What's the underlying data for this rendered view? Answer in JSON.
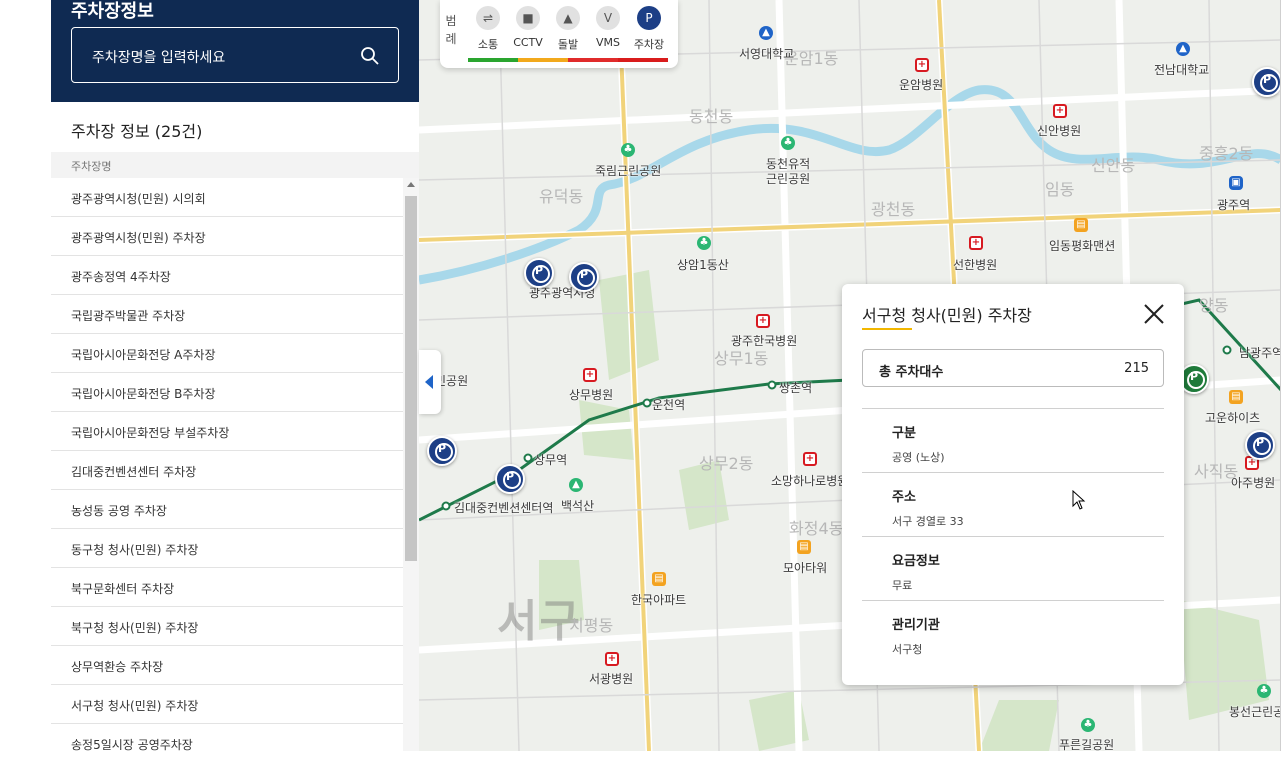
{
  "sidebar": {
    "title": "주차장정보",
    "search_placeholder": "주차장명을 입력하세요",
    "count_label": "주차장 정보 (25건)",
    "column_header": "주차장명",
    "items": [
      "광주광역시청(민원) 시의회",
      "광주광역시청(민원) 주차장",
      "광주송정역 4주차장",
      "국립광주박물관 주차장",
      "국립아시아문화전당 A주차장",
      "국립아시아문화전당 B주차장",
      "국립아시아문화전당 부설주차장",
      "김대중컨벤션센터 주차장",
      "농성동 공영 주차장",
      "동구청 청사(민원) 주차장",
      "북구문화센터 주차장",
      "북구청 청사(민원) 주차장",
      "상무역환승 주차장",
      "서구청 청사(민원) 주차장",
      "송정5일시장 공영주차장"
    ]
  },
  "legend": {
    "title": "범례",
    "items": [
      {
        "label": "소통",
        "icon": "arrows-icon",
        "glyph": "⇌",
        "bar_color": "#2aa52f"
      },
      {
        "label": "CCTV",
        "icon": "camera-icon",
        "glyph": "■",
        "bar_color": "#f2a91c"
      },
      {
        "label": "돌발",
        "icon": "warning-icon",
        "glyph": "▲",
        "bar_color": "#e02b2b"
      },
      {
        "label": "VMS",
        "icon": "vms-icon",
        "glyph": "V",
        "bar_color": "#d91c1c"
      },
      {
        "label": "주차장",
        "icon": "parking-icon",
        "glyph": "P",
        "bar_color": "#77787f"
      }
    ]
  },
  "detail": {
    "title": "서구청 청사(민원) 주차장",
    "total_label": "총 주차대수",
    "total_value": "215",
    "sections": [
      {
        "key": "구분",
        "value": "공영 (노상)"
      },
      {
        "key": "주소",
        "value": "서구 경열로 33"
      },
      {
        "key": "요금정보",
        "value": "무료"
      },
      {
        "key": "관리기관",
        "value": "서구청"
      }
    ]
  },
  "map": {
    "district": "서구",
    "places": [
      {
        "name": "서영대학교",
        "kind": "school"
      },
      {
        "name": "운암병원",
        "kind": "hosp"
      },
      {
        "name": "전남대학교",
        "kind": "school"
      },
      {
        "name": "신안병원",
        "kind": "hosp"
      },
      {
        "name": "죽림근린공원",
        "kind": "park"
      },
      {
        "name": "동천유적\n근린공원",
        "kind": "park"
      },
      {
        "name": "광주역",
        "kind": "sta"
      },
      {
        "name": "임동평화맨션",
        "kind": "apt"
      },
      {
        "name": "상암1동산",
        "kind": "park"
      },
      {
        "name": "선한병원",
        "kind": "hosp"
      },
      {
        "name": "광주광역시청",
        "kind": "none"
      },
      {
        "name": "광주한국병원",
        "kind": "hosp"
      },
      {
        "name": "상무병원",
        "kind": "hosp"
      },
      {
        "name": "운천역",
        "kind": "none"
      },
      {
        "name": "쌍촌역",
        "kind": "none"
      },
      {
        "name": "상무역",
        "kind": "none"
      },
      {
        "name": "김대중컨벤션센터역",
        "kind": "none"
      },
      {
        "name": "백석산",
        "kind": "park"
      },
      {
        "name": "소망하나로병원",
        "kind": "hosp"
      },
      {
        "name": "모아타워",
        "kind": "apt"
      },
      {
        "name": "한국아파트",
        "kind": "apt"
      },
      {
        "name": "서광병원",
        "kind": "hosp"
      },
      {
        "name": "푸른길공원",
        "kind": "park"
      },
      {
        "name": "봉선근린공원",
        "kind": "park"
      },
      {
        "name": "고운하이츠",
        "kind": "apt"
      },
      {
        "name": "아주병원",
        "kind": "hosp"
      },
      {
        "name": "남광주역",
        "kind": "none"
      },
      {
        "name": "민공원",
        "kind": "none"
      }
    ],
    "dongs": [
      "운암1동",
      "동천동",
      "유덕동",
      "광천동",
      "신안동",
      "임동",
      "상무1동",
      "상무2동",
      "치평동",
      "화정4동",
      "중흥2동",
      "양동",
      "사직동"
    ]
  },
  "colors": {
    "header_bg": "#0f2a52",
    "pin": "#1d3f86",
    "accent": "#f2b700",
    "subway": "#1e7a4a"
  }
}
